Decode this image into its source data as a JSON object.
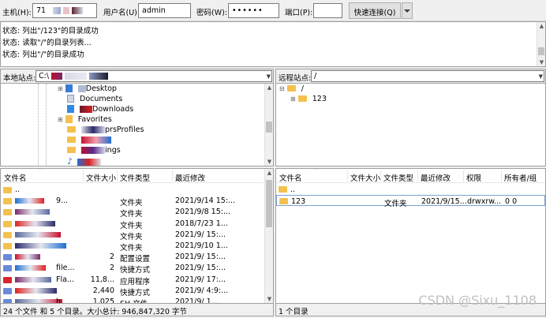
{
  "toolbar": {
    "host_label": "主机(H):",
    "host_value": "71",
    "user_label": "用户名(U):",
    "user_value": "admin",
    "password_label": "密码(W):",
    "password_value": "••••••",
    "port_label": "端口(P):",
    "port_value": "",
    "quickconnect_label": "快速连接(Q)",
    "dropdown_icon": "chevron-down-icon"
  },
  "log": {
    "lines": [
      "状态: 列出\"/123\"的目录成功",
      "状态: 读取\"/\"的目录列表...",
      "状态: 列出\"/\"的目录成功"
    ]
  },
  "local": {
    "site_label": "本地站点:",
    "path_value": "C:\\",
    "tree": [
      "Desktop",
      "Documents",
      "Downloads",
      "Favorites",
      "prsProfiles",
      "",
      "ings",
      ""
    ],
    "headers": [
      "文件名",
      "文件大小",
      "文件类型",
      "最近修改"
    ],
    "files": [
      {
        "name": "..",
        "size": "",
        "type": "",
        "modified": ""
      },
      {
        "name": "9...",
        "size": "",
        "type": "文件夹",
        "modified": "2021/9/14 15:..."
      },
      {
        "name": "",
        "size": "",
        "type": "文件夹",
        "modified": "2021/9/8 15:..."
      },
      {
        "name": "",
        "size": "",
        "type": "文件夹",
        "modified": "2018/7/23 1..."
      },
      {
        "name": "",
        "size": "",
        "type": "文件夹",
        "modified": "2021/9/ 15:..."
      },
      {
        "name": "",
        "size": "",
        "type": "文件夹",
        "modified": "2021/9/10 1..."
      },
      {
        "name": "",
        "size": "2",
        "type": "配置设置",
        "modified": "2021/9/ 15:..."
      },
      {
        "name": "file...",
        "size": "2",
        "type": "快捷方式",
        "modified": "2021/9/ 15:..."
      },
      {
        "name": "Fla...",
        "size": "11,8...",
        "type": "应用程序",
        "modified": "2021/9/ 17:..."
      },
      {
        "name": "",
        "size": "2,440",
        "type": "快捷方式",
        "modified": "2021/9/ 4:9:..."
      },
      {
        "name": "h",
        "size": "1,025",
        "type": "SH 文件",
        "modified": "2021/9/ 1..."
      }
    ],
    "status": "24 个文件 和 5 个目录。大小总计: 946,847,320 字节"
  },
  "remote": {
    "site_label": "远程站点:",
    "path_value": "/",
    "tree": [
      "/",
      "123"
    ],
    "headers": [
      "文件名",
      "文件大小",
      "文件类型",
      "最近修改",
      "权限",
      "所有者/组"
    ],
    "files": [
      {
        "name": "..",
        "size": "",
        "type": "",
        "modified": "",
        "perms": "",
        "owner": ""
      },
      {
        "name": "123",
        "size": "",
        "type": "文件夹",
        "modified": "2021/9/15...",
        "perms": "drwxrw...",
        "owner": "0 0"
      }
    ],
    "status": "1 个目录"
  },
  "watermark": "CSDN @Sixu_1108",
  "colors": {
    "folder": "#f3c150",
    "selected_border": "#7da2ce",
    "blur_red": "#c8102e",
    "blur_blue": "#1e6fd0"
  }
}
